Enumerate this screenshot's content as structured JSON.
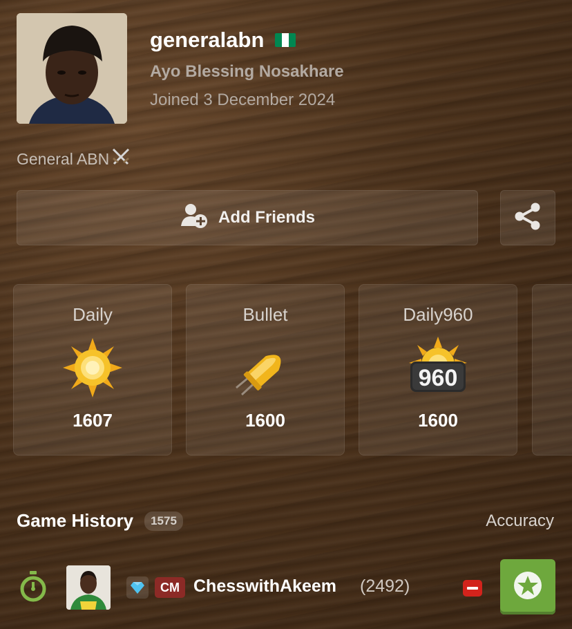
{
  "profile": {
    "username": "generalabn",
    "full_name": "Ayo Blessing Nosakhare",
    "joined": "Joined 3 December 2024",
    "status": "General ABN",
    "country_flag_colors": [
      "#008751",
      "#ffffff",
      "#008751"
    ]
  },
  "actions": {
    "add_friends_label": "Add Friends",
    "add_friends_icon": "add-person-icon",
    "share_icon": "share-icon"
  },
  "stats": [
    {
      "label": "Daily",
      "rating": "1607",
      "icon": "sun-icon"
    },
    {
      "label": "Bullet",
      "rating": "1600",
      "icon": "bullet-icon"
    },
    {
      "label": "Daily960",
      "rating": "1600",
      "icon": "daily960-icon",
      "icon_text": "960"
    }
  ],
  "game_history": {
    "title": "Game History",
    "count": "1575",
    "accuracy_label": "Accuracy",
    "games": [
      {
        "time_icon": "stopwatch-icon",
        "opponent_title": "CM",
        "opponent_name": "ChesswithAkeem",
        "opponent_rating": "(2492)",
        "result": "draw",
        "review_icon": "star-icon"
      }
    ]
  },
  "colors": {
    "accent_green": "#6ea83d",
    "title_badge": "#8c2a26",
    "draw_red": "#d3231c"
  }
}
